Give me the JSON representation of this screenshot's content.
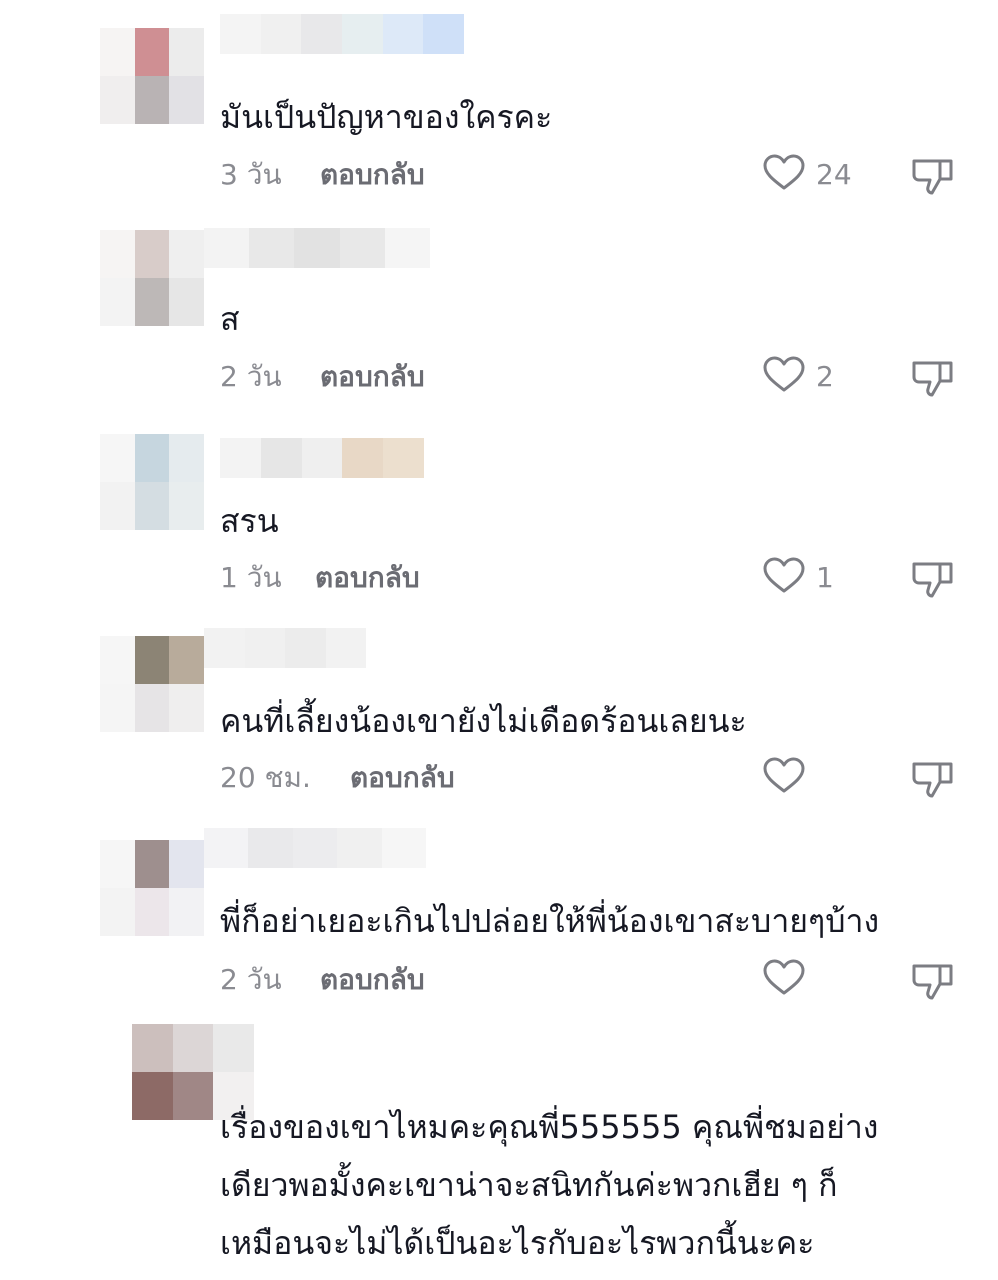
{
  "comments": [
    {
      "text_lines": [
        "มันเป็นปัญหาของใครคะ"
      ],
      "time": "3 วัน",
      "reply_label": "ตอบกลับ",
      "likes": "24",
      "avatar_colors": [
        "#f6f4f3",
        "#cf8f93",
        "#ececec",
        "#f0eeee",
        "#b9b3b4",
        "#e2e1e5"
      ],
      "name_colors": [
        "#f4f4f4",
        "#f0f0f0",
        "#e8e8ea",
        "#e6eef0",
        "#dde9f8",
        "#cfe0f8"
      ]
    },
    {
      "text_lines": [
        "ส"
      ],
      "time": "2 วัน",
      "reply_label": "ตอบกลับ",
      "likes": "2",
      "avatar_colors": [
        "#f6f4f3",
        "#d8ccc9",
        "#efefef",
        "#f3f3f3",
        "#bdb8b7",
        "#e6e6e6"
      ],
      "name_colors": [
        "#f3f3f3",
        "#e8e8e8",
        "#e2e2e2",
        "#e8e8e8",
        "#f5f5f5"
      ]
    },
    {
      "text_lines": [
        "สรน"
      ],
      "time": "1 วัน",
      "reply_label": "ตอบกลับ",
      "likes": "1",
      "avatar_colors": [
        "#f6f6f6",
        "#c6d6df",
        "#e5ebee",
        "#f2f2f2",
        "#d4dde2",
        "#e8edee"
      ],
      "name_colors": [
        "#f3f3f3",
        "#e6e6e6",
        "#efefef",
        "#e8d8c6",
        "#ecdfce"
      ]
    },
    {
      "text_lines": [
        "คนที่เลี้ยงน้องเขายังไม่เดือดร้อนเลยนะ"
      ],
      "time": "20 ชม.",
      "reply_label": "ตอบกลับ",
      "likes": "",
      "avatar_colors": [
        "#f6f6f6",
        "#8c8475",
        "#b8ab9b",
        "#f5f5f5",
        "#e6e4e6",
        "#efeeee"
      ],
      "name_colors": [
        "#f2f2f2",
        "#f0f0f0",
        "#ececec",
        "#f2f2f2"
      ]
    },
    {
      "text_lines": [
        "พี่ก็อย่าเยอะเกินไปปล่อยให้พี่น้องเขาสะบายๆบ้าง"
      ],
      "time": "2 วัน",
      "reply_label": "ตอบกลับ",
      "likes": "",
      "avatar_colors": [
        "#f6f6f6",
        "#9e8f8e",
        "#e3e5ee",
        "#f3f3f3",
        "#ece6ea",
        "#f2f2f4"
      ],
      "name_colors": [
        "#f3f3f5",
        "#e9e9eb",
        "#ececee",
        "#f0f0f0",
        "#f6f6f6"
      ]
    },
    {
      "text_lines": [
        "เรื่องของเขาไหมคะคุณพี่555555 คุณพี่ชมอย่าง",
        "เดียวพอมั้งคะเขาน่าจะสนิทกันค่ะพวกเฮีย ๆ ก็",
        "เหมือนจะไม่ได้เป็นอะไรกับอะไรพวกนี้นะคะ"
      ],
      "time": "",
      "reply_label": "",
      "likes": "",
      "avatar_colors": [
        "#ccbfbd",
        "#dcd6d6",
        "#e9e9e9",
        "#8d6a66",
        "#a08786",
        "#f2f0f0"
      ],
      "name_colors": []
    }
  ]
}
